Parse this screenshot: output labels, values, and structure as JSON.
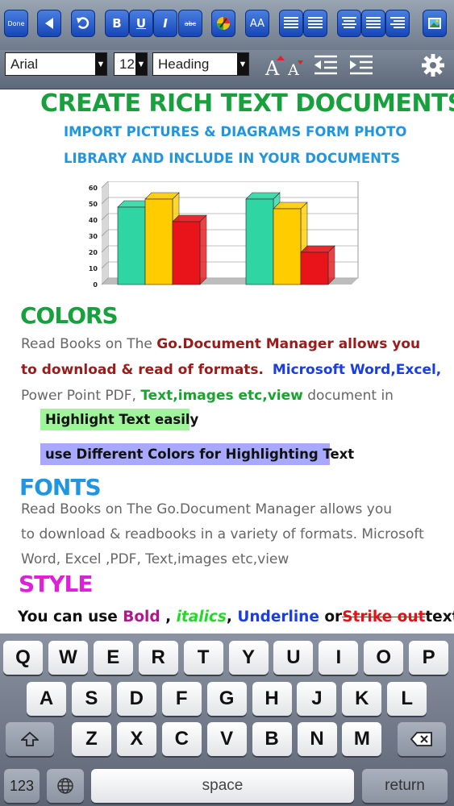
{
  "toolbar": {
    "done_label": "Done",
    "bold_label": "B",
    "underline_label": "U",
    "italic_label": "I",
    "strike_label": "abc",
    "font_size_label": "AA"
  },
  "format_bar": {
    "font_value": "Arial",
    "size_value": "12",
    "style_value": "Heading"
  },
  "document": {
    "title": "CREATE RICH TEXT DOCUMENTS",
    "subtitle_line1": "IMPORT PICTURES & DIAGRAMS FORM PHOTO",
    "subtitle_line2": "LIBRARY AND INCLUDE IN YOUR DOCUMENTS",
    "colors_heading": "COLORS",
    "colors_p1_a": "Read Books on The ",
    "colors_p1_b": "Go.Document Manager allows you",
    "colors_p2_a": "to download & read of formats.",
    "colors_p2_b": "Microsoft Word,Excel,",
    "colors_p3_a": "Power Point PDF, ",
    "colors_p3_b": "Text,images etc,view",
    "colors_p3_c": " document in",
    "highlight1": "Highlight Text easily",
    "highlight2": "use Different  Colors for Highlighting Text",
    "fonts_heading": "FONTS",
    "fonts_p1": "Read Books on The Go.Document Manager allows you",
    "fonts_p2": "to download & readbooks in a variety of formats. Microsoft",
    "fonts_p3": "Word, Excel ,PDF, Text,images etc,view",
    "style_heading": "STYLE",
    "style_a": "You can use ",
    "style_bold": "Bold",
    "style_comma1": " , ",
    "style_italics": "italics",
    "style_comma2": ", ",
    "style_underline": "Underline",
    "style_or": " or",
    "style_strike": "Strike out",
    "style_end": "text"
  },
  "chart_data": {
    "type": "bar",
    "categories": [
      "",
      ""
    ],
    "series": [
      {
        "color": "#2fd6a4",
        "values": [
          48,
          53
        ]
      },
      {
        "color": "#ffcc00",
        "values": [
          53,
          47
        ]
      },
      {
        "color": "#e8141a",
        "values": [
          39,
          20
        ]
      }
    ],
    "y_ticks": [
      "0",
      "10",
      "20",
      "30",
      "40",
      "50",
      "60"
    ],
    "ylim": [
      0,
      60
    ],
    "grid": true
  },
  "keyboard": {
    "row1": [
      "Q",
      "W",
      "E",
      "R",
      "T",
      "Y",
      "U",
      "I",
      "O",
      "P"
    ],
    "row2": [
      "A",
      "S",
      "D",
      "F",
      "G",
      "H",
      "J",
      "K",
      "L"
    ],
    "row3": [
      "Z",
      "X",
      "C",
      "V",
      "B",
      "N",
      "M"
    ],
    "numbers_label": "123",
    "space_label": "space",
    "return_label": "return"
  },
  "colors": {
    "title_green": "#18a03c",
    "subtitle_blue": "#2196e0",
    "dark_red": "#9b1a1a",
    "blue": "#1a3ee0",
    "green": "#17a52e",
    "magenta": "#e01fd8",
    "highlight_green": "#9ff59a",
    "highlight_blue": "#a8a8ff"
  }
}
